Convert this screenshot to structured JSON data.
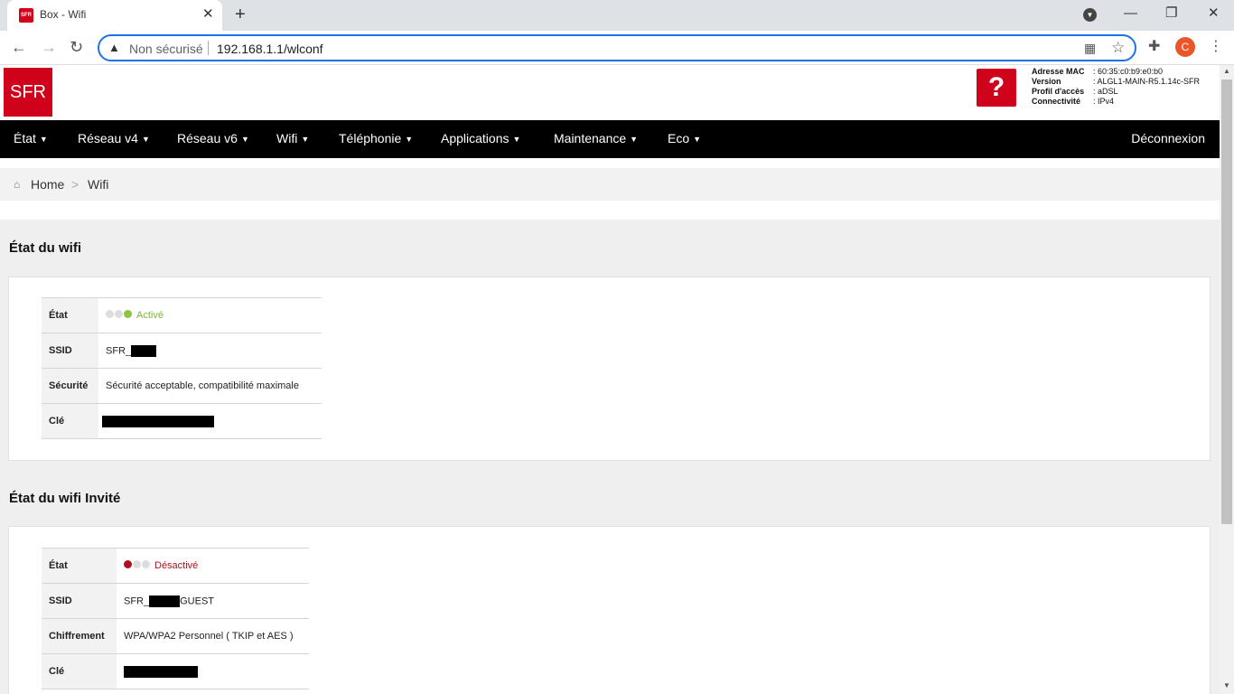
{
  "browser": {
    "tab_title": "Box - Wifi",
    "tab_favicon_text": "SFR",
    "new_tab_label": "+",
    "omnibox_security": "Non sécurisé",
    "omnibox_url": "192.168.1.1/wlconf",
    "profile_initial": "C"
  },
  "header": {
    "logo": "SFR",
    "help": "?",
    "device_info": [
      {
        "label": "Adresse MAC",
        "value": ": 60:35:c0:b9:e0:b0"
      },
      {
        "label": "Version",
        "value": ": ALGL1-MAIN-R5.1.14c-SFR"
      },
      {
        "label": "Profil d'accès",
        "value": ": aDSL"
      },
      {
        "label": "Connectivité",
        "value": ": IPv4"
      }
    ]
  },
  "nav": {
    "items": [
      "État",
      "Réseau v4",
      "Réseau v6",
      "Wifi",
      "Téléphonie",
      "Applications",
      "Maintenance",
      "Eco"
    ],
    "logout": "Déconnexion"
  },
  "breadcrumb": {
    "home": "Home",
    "separator": ">",
    "current": "Wifi"
  },
  "wifi": {
    "title": "État du wifi",
    "rows": {
      "state_label": "État",
      "state_value": "Activé",
      "ssid_label": "SSID",
      "ssid_prefix": "SFR_",
      "security_label": "Sécurité",
      "security_value": "Sécurité acceptable, compatibilité maximale",
      "key_label": "Clé"
    }
  },
  "guest": {
    "title": "État du wifi Invité",
    "rows": {
      "state_label": "État",
      "state_value": "Désactivé",
      "ssid_label": "SSID",
      "ssid_prefix": "SFR_",
      "ssid_suffix": "GUEST",
      "cipher_label": "Chiffrement",
      "cipher_value": "WPA/WPA2 Personnel ( TKIP et AES )",
      "key_label": "Clé"
    }
  },
  "colors": {
    "brand": "#d0021b",
    "active": "#8dc63f",
    "inactive": "#b20f1d"
  }
}
